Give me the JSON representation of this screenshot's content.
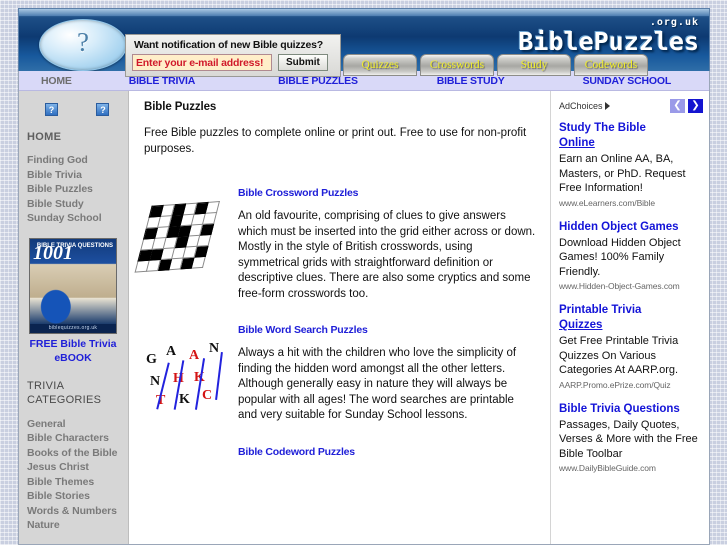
{
  "header": {
    "logo_icon": "question-mark-ball-icon",
    "brand_tld": ".org.uk",
    "brand_name": "BiblePuzzles",
    "signup": {
      "prompt": "Want notification of new Bible quizzes?",
      "email_value": "Enter your e-mail address!",
      "email_placeholder": "Enter your e-mail address!",
      "submit_label": "Submit"
    },
    "tabs": [
      {
        "label": "Quizzes"
      },
      {
        "label": "Crosswords"
      },
      {
        "label": "Study"
      },
      {
        "label": "Codewords"
      }
    ]
  },
  "subnav": {
    "items": [
      {
        "label": "HOME",
        "current": true
      },
      {
        "label": "BIBLE TRIVIA",
        "current": false
      },
      {
        "label": "BIBLE PUZZLES",
        "current": false
      },
      {
        "label": "BIBLE STUDY",
        "current": false
      },
      {
        "label": "SUNDAY SCHOOL",
        "current": false
      }
    ]
  },
  "sidebar": {
    "broken_icon_glyph": "?",
    "home_label": "HOME",
    "nav": [
      {
        "label": "Finding God"
      },
      {
        "label": "Bible Trivia"
      },
      {
        "label": "Bible Puzzles"
      },
      {
        "label": "Bible Study"
      },
      {
        "label": "Sunday School"
      }
    ],
    "ebook": {
      "cover_number": "1001",
      "cover_sub": "BIBLE TRIVIA QUESTIONS",
      "cover_footer": "biblequizzes.org.uk",
      "caption": "FREE Bible Trivia eBOOK"
    },
    "categories_heading": "TRIVIA CATEGORIES",
    "categories": [
      {
        "label": "General"
      },
      {
        "label": "Bible Characters"
      },
      {
        "label": "Books of the Bible"
      },
      {
        "label": "Jesus Christ"
      },
      {
        "label": "Bible Themes"
      },
      {
        "label": "Bible Stories"
      },
      {
        "label": "Words & Numbers"
      },
      {
        "label": "Nature"
      }
    ]
  },
  "main": {
    "title": "Bible Puzzles",
    "intro": "Free Bible puzzles to complete online or print out. Free to use for non-profit purposes.",
    "sections": [
      {
        "title": "Bible Crossword Puzzles",
        "thumb": "crossword-grid-thumbnail",
        "body": "An old favourite, comprising of clues to give answers which must be inserted into the grid either across or down. Mostly in the style of British crosswords, using symmetrical grids with straightforward definition or descriptive clues. There are also some cryptics and some free-form crosswords too."
      },
      {
        "title": "Bible Word Search Puzzles",
        "thumb": "word-search-thumbnail",
        "body": "Always a hit with the children who love the simplicity of finding the hidden word amongst all the other letters. Although generally easy in nature they will always be popular with all ages! The word searches are printable and very suitable for Sunday School lessons."
      },
      {
        "title": "Bible Codeword Puzzles",
        "thumb": "",
        "body": ""
      }
    ],
    "wordsearch_letters": [
      "G",
      "A",
      "A",
      "N",
      "N",
      "H",
      "K",
      "T",
      "K",
      "C"
    ]
  },
  "ads": {
    "adchoices_label": "AdChoices",
    "prev_glyph": "❮",
    "next_glyph": "❯",
    "items": [
      {
        "title_line1": "Study The Bible",
        "title_line2": "Online",
        "desc": "Earn an Online AA, BA, Masters, or PhD. Request Free Information!",
        "url": "www.eLearners.com/Bible"
      },
      {
        "title_line1": "Hidden Object Games",
        "title_line2": "",
        "desc": "Download Hidden Object Games! 100% Family Friendly.",
        "url": "www.Hidden-Object-Games.com"
      },
      {
        "title_line1": "Printable Trivia",
        "title_line2": "Quizzes",
        "desc": "Get Free Printable Trivia Quizzes On Various Categories At AARP.org.",
        "url": "AARP.Promo.ePrize.com/Quiz"
      },
      {
        "title_line1": "Bible Trivia Questions",
        "title_line2": "",
        "desc": "Passages, Daily Quotes, Verses & More with the Free Bible Toolbar",
        "url": "www.DailyBibleGuide.com"
      }
    ]
  },
  "colors": {
    "header_blue": "#0d3a72",
    "tab_yellow": "#f2ef2a",
    "link_blue": "#2020d8",
    "subnav_bg": "#d9d9f8",
    "sidebar_bg": "#d6d6d6"
  }
}
